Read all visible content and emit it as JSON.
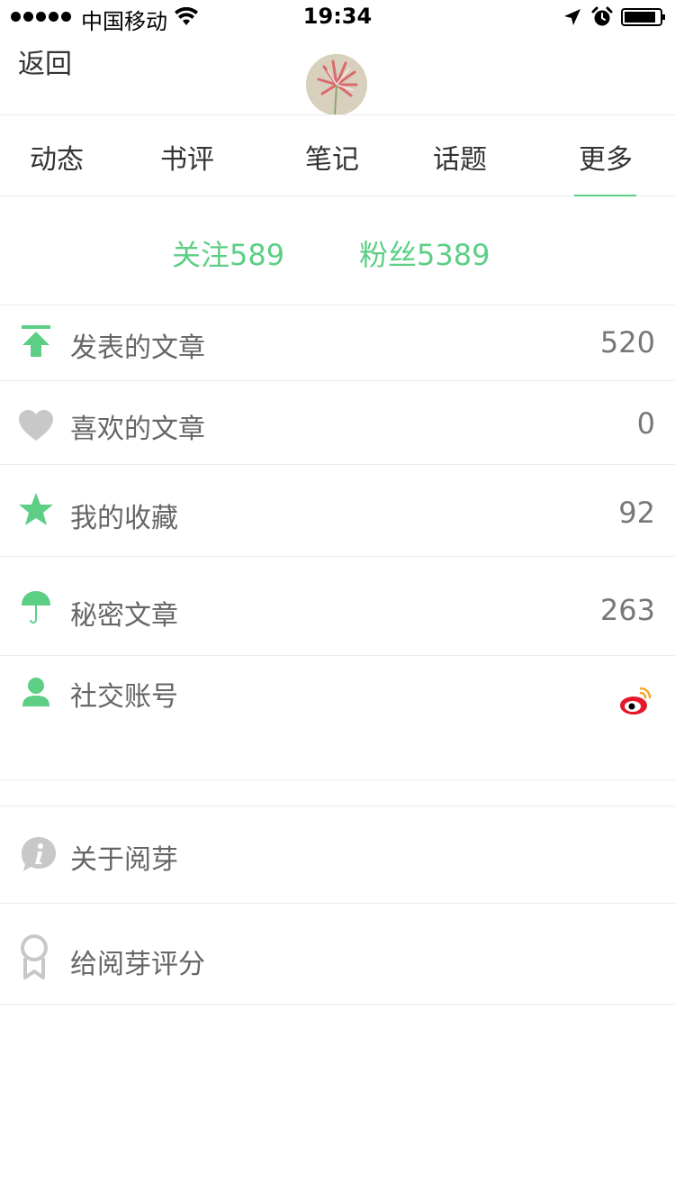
{
  "status_bar": {
    "carrier": "中国移动",
    "time": "19:34"
  },
  "nav": {
    "back_label": "返回"
  },
  "tabs": [
    {
      "label": "动态"
    },
    {
      "label": "书评"
    },
    {
      "label": "笔记"
    },
    {
      "label": "话题"
    },
    {
      "label": "更多",
      "active": true
    }
  ],
  "follow": {
    "following": "关注589",
    "followers": "粉丝5389"
  },
  "list": [
    {
      "label": "发表的文章",
      "value": "520",
      "icon": "upload-icon"
    },
    {
      "label": "喜欢的文章",
      "value": "0",
      "icon": "heart-icon"
    },
    {
      "label": "我的收藏",
      "value": "92",
      "icon": "star-icon"
    },
    {
      "label": "秘密文章",
      "value": "263",
      "icon": "umbrella-icon"
    },
    {
      "label": "社交账号",
      "value": "",
      "icon": "person-icon"
    }
  ],
  "more_list": [
    {
      "label": "关于阅芽",
      "icon": "info-icon"
    },
    {
      "label": "给阅芽评分",
      "icon": "award-icon"
    }
  ],
  "colors": {
    "accent": "#5ccf85",
    "text": "#333333",
    "muted": "#777777",
    "divider": "#ececec"
  }
}
